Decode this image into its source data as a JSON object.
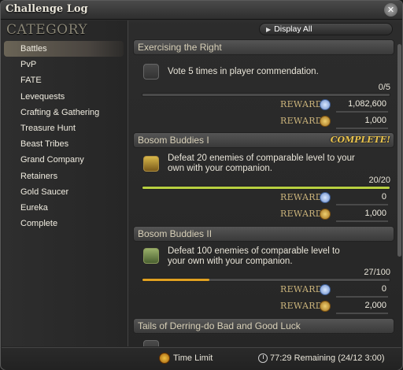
{
  "window": {
    "title": "Challenge Log",
    "close_label": "✕"
  },
  "sidebar": {
    "heading": "CATEGORY",
    "items": [
      {
        "label": "Battles",
        "active": true
      },
      {
        "label": "PvP"
      },
      {
        "label": "FATE"
      },
      {
        "label": "Levequests"
      },
      {
        "label": "Crafting & Gathering"
      },
      {
        "label": "Treasure Hunt"
      },
      {
        "label": "Beast Tribes"
      },
      {
        "label": "Grand Company"
      },
      {
        "label": "Retainers"
      },
      {
        "label": "Gold Saucer"
      },
      {
        "label": "Eureka"
      },
      {
        "label": "Complete"
      }
    ]
  },
  "toolbar": {
    "display_all_label": "Display All"
  },
  "entries": [
    {
      "title": "Exercising the Right",
      "description": "Vote 5 times in player commendation.",
      "progress": "0/5",
      "progress_fraction": 0.0,
      "rewards": [
        {
          "label": "REWARD",
          "icon": "star-seal-icon",
          "value": "1,082,600"
        },
        {
          "label": "REWARD",
          "icon": "gil-coin-icon",
          "value": "1,000"
        }
      ]
    },
    {
      "title": "Bosom Buddies I",
      "complete_label": "COMPLETE!",
      "description_line1": "Defeat 20 enemies of comparable level to your",
      "description_line2": "own with your companion.",
      "progress": "20/20",
      "progress_fraction": 1.0,
      "rewards": [
        {
          "label": "REWARD",
          "icon": "star-seal-icon",
          "value": "0"
        },
        {
          "label": "REWARD",
          "icon": "gil-coin-icon",
          "value": "1,000"
        }
      ]
    },
    {
      "title": "Bosom Buddies II",
      "description_line1": "Defeat 100 enemies of comparable level to",
      "description_line2": "your own with your companion.",
      "progress": "27/100",
      "progress_fraction": 0.27,
      "rewards": [
        {
          "label": "REWARD",
          "icon": "star-seal-icon",
          "value": "0"
        },
        {
          "label": "REWARD",
          "icon": "gil-coin-icon",
          "value": "2,000"
        }
      ]
    },
    {
      "title": "Tails of Derring-do Bad and Good Luck"
    }
  ],
  "footer": {
    "time_limit_label": "Time Limit",
    "remaining_label": "77:29 Remaining (24/12 3:00)"
  },
  "colors": {
    "bar_complete": "#b8d040",
    "bar_progress": "#e0a020",
    "complete_text": "#e9c34c"
  }
}
